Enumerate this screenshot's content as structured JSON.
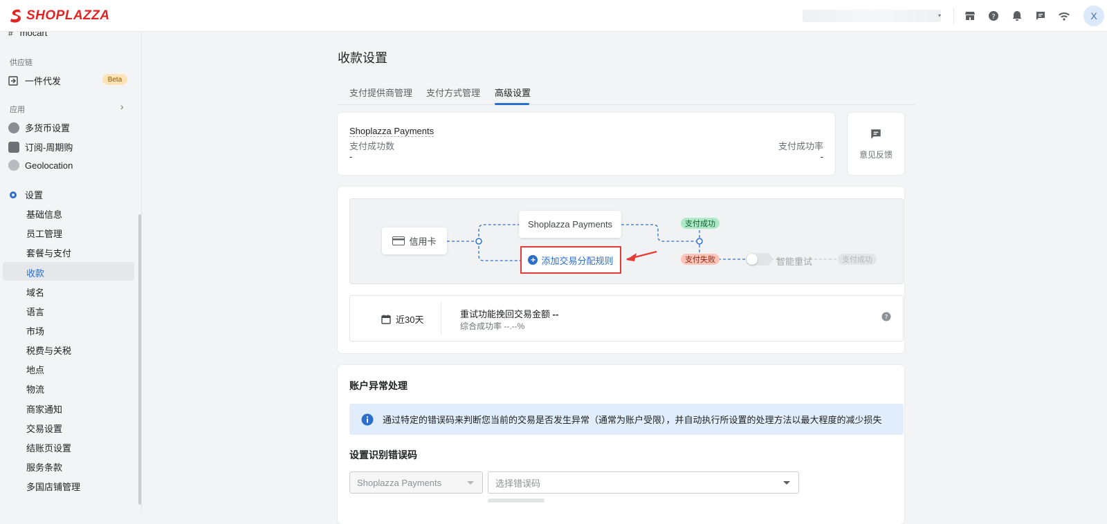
{
  "app": {
    "logo_text": "SHOPLAZZA",
    "brand_color": "#e02424",
    "accent_color": "#2c6ecb",
    "user_initial": "X"
  },
  "topbar": {
    "icons": [
      "store-icon",
      "help-icon",
      "bell-icon",
      "chat-icon",
      "wifi-icon"
    ]
  },
  "sidebar": {
    "partial_item": "mocart",
    "supply_section": "供应链",
    "dropship": {
      "label": "一件代发",
      "badge": "Beta"
    },
    "apps_section": "应用",
    "apps": [
      {
        "label": "多货币设置"
      },
      {
        "label": "订阅-周期购"
      },
      {
        "label": "Geolocation"
      }
    ],
    "settings": "设置",
    "settings_items": [
      {
        "label": "基础信息"
      },
      {
        "label": "员工管理"
      },
      {
        "label": "套餐与支付"
      },
      {
        "label": "收款",
        "active": true
      },
      {
        "label": "域名"
      },
      {
        "label": "语言"
      },
      {
        "label": "市场"
      },
      {
        "label": "税费与关税"
      },
      {
        "label": "地点"
      },
      {
        "label": "物流"
      },
      {
        "label": "商家通知"
      },
      {
        "label": "交易设置"
      },
      {
        "label": "结账页设置"
      },
      {
        "label": "服务条款"
      },
      {
        "label": "多国店铺管理"
      }
    ]
  },
  "page": {
    "title": "收款设置",
    "tabs": [
      {
        "label": "支付提供商管理"
      },
      {
        "label": "支付方式管理"
      },
      {
        "label": "高级设置",
        "active": true
      }
    ]
  },
  "summary": {
    "provider": "Shoplazza Payments",
    "success_count_label": "支付成功数",
    "success_count_value": "-",
    "success_rate_label": "支付成功率",
    "success_rate_value": "-",
    "feedback_label": "意见反馈"
  },
  "flow": {
    "source": "信用卡",
    "provider": "Shoplazza Payments",
    "add_rule": "添加交易分配规则",
    "success_pill": "支付成功",
    "fail_pill": "支付失败",
    "retry_label": "智能重试",
    "retry_success_pill": "支付成功",
    "retry_enabled": false
  },
  "kpi": {
    "range": "近30天",
    "recovered_label": "重试功能挽回交易金额",
    "recovered_value": "--",
    "rate_label": "综合成功率",
    "rate_value": "--.--%"
  },
  "exceptions": {
    "title": "账户异常处理",
    "info": "通过特定的错误码来判断您当前的交易是否发生异常（通常为账户受限），并自动执行所设置的处理方法以最大程度的减少损失",
    "subtitle": "设置识别错误码",
    "provider_select": "Shoplazza Payments",
    "code_placeholder": "选择错误码"
  }
}
